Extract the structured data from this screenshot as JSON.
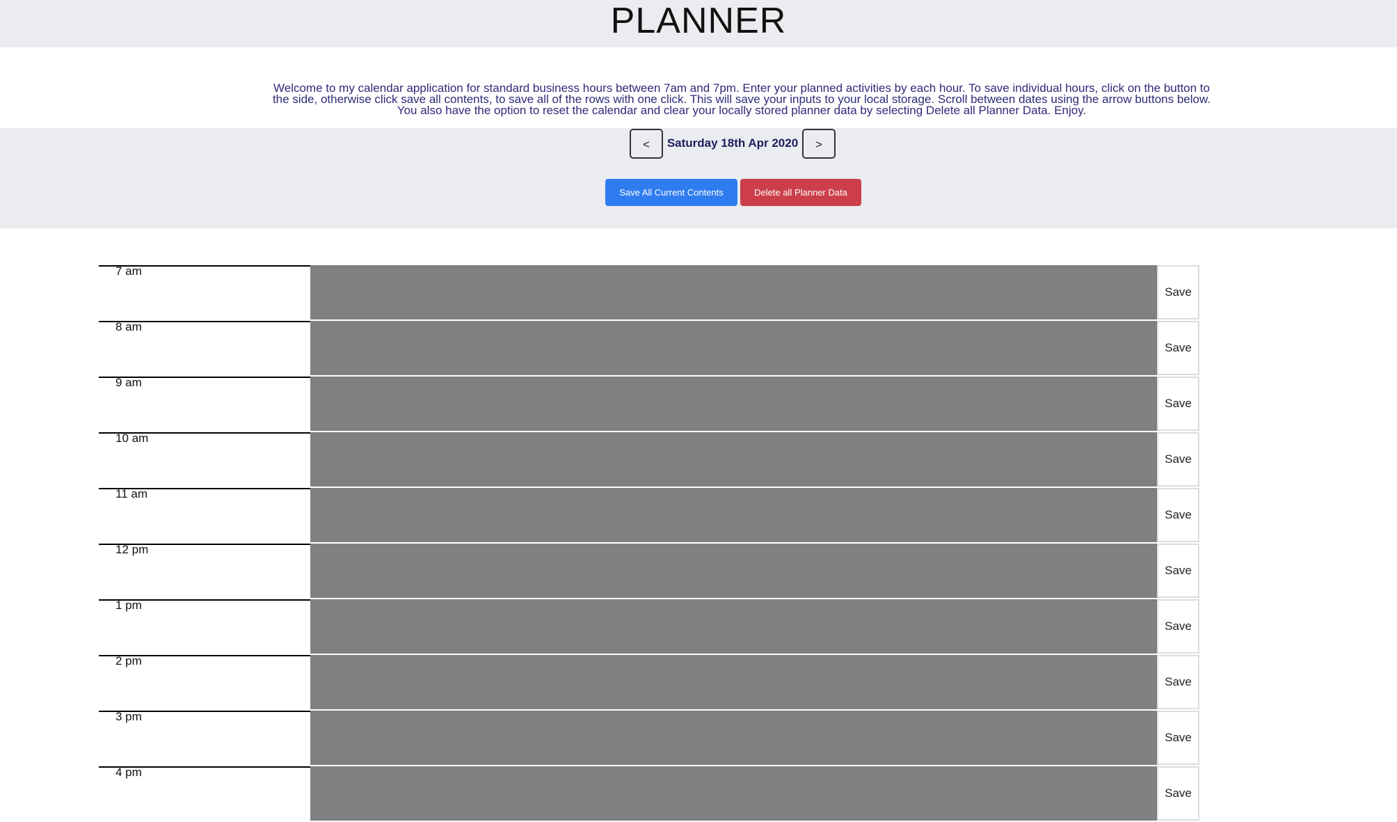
{
  "app": {
    "title": "PLANNER",
    "intro": "Welcome to my calendar application for standard business hours between 7am and 7pm. Enter your planned activities by each hour. To save individual hours, click on the button to the side, otherwise click save all contents, to save all of the rows with one click. This will save your inputs to your local storage. Scroll between dates using the arrow buttons below. You also have the option to reset the calendar and clear your locally stored planner data by selecting Delete all Planner Data. Enjoy."
  },
  "nav": {
    "prev_label": "<",
    "next_label": ">",
    "current_date": "Saturday 18th Apr 2020"
  },
  "actions": {
    "save_all_label": "Save All Current Contents",
    "delete_all_label": "Delete all Planner Data"
  },
  "rows": [
    {
      "hour": "7 am",
      "value": "",
      "save_label": "Save"
    },
    {
      "hour": "8 am",
      "value": "",
      "save_label": "Save"
    },
    {
      "hour": "9 am",
      "value": "",
      "save_label": "Save"
    },
    {
      "hour": "10 am",
      "value": "",
      "save_label": "Save"
    },
    {
      "hour": "11 am",
      "value": "",
      "save_label": "Save"
    },
    {
      "hour": "12 pm",
      "value": "",
      "save_label": "Save"
    },
    {
      "hour": "1 pm",
      "value": "",
      "save_label": "Save"
    },
    {
      "hour": "2 pm",
      "value": "",
      "save_label": "Save"
    },
    {
      "hour": "3 pm",
      "value": "",
      "save_label": "Save"
    },
    {
      "hour": "4 pm",
      "value": "",
      "save_label": "Save"
    }
  ],
  "colors": {
    "band_background": "#ebecf0",
    "save_all": "#2f7cf0",
    "delete_all": "#cc3f4a",
    "past_hour": "#808080",
    "intro_text": "#2e2a78"
  }
}
